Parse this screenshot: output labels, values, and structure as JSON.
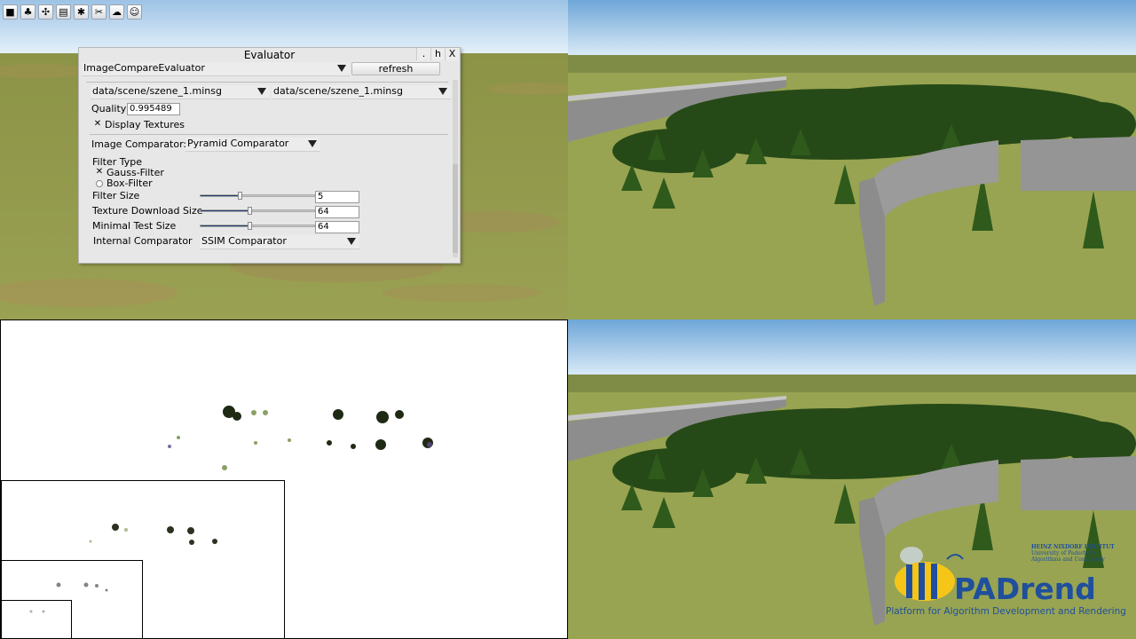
{
  "toolbar": {
    "icons": [
      "folder-icon",
      "tree-icon",
      "puzzle-icon",
      "notepad-icon",
      "gear-icon",
      "tools-icon",
      "weather-icon",
      "smiley-icon"
    ],
    "glyphs": [
      "■",
      "♣",
      "✣",
      "▤",
      "✱",
      "✂",
      "☁",
      "☺"
    ]
  },
  "evaluator": {
    "title": "Evaluator",
    "window_buttons": [
      ".",
      "h",
      "X"
    ],
    "evaluator_select": "ImageCompareEvaluator",
    "refresh_label": "refresh",
    "scene_left": "data/scene/szene_1.minsg",
    "scene_right": "data/scene/szene_1.minsg",
    "quality_label": "Quality",
    "quality_value": "0.995489",
    "display_textures_label": "Display Textures",
    "image_comparator_label": "Image Comparator:",
    "image_comparator_value": "Pyramid Comparator",
    "filter_type_label": "Filter Type",
    "gauss_filter_label": "Gauss-Filter",
    "box_filter_label": "Box-Filter",
    "selected_filter": "Gauss-Filter",
    "filter_size_label": "Filter Size",
    "filter_size_value": "5",
    "filter_size_level": 0.34,
    "texture_download_label": "Texture Download Size",
    "texture_download_value": "64",
    "texture_download_level": 0.43,
    "minimal_test_label": "Minimal Test Size",
    "minimal_test_value": "64",
    "minimal_test_level": 0.43,
    "internal_comparator_label": "Internal Comparator",
    "internal_comparator_value": "SSIM Comparator"
  },
  "logo": {
    "name": "PADrend",
    "subtitle": "Platform for Algorithm Development and Rendering",
    "institute": "HEINZ NIXDORF INSTITUT",
    "university_line1": "University of Paderborn",
    "university_line2": "Algorithms and Complexity"
  },
  "colors": {
    "sky_top": "#8fb8dd",
    "sky_bottom": "#dcecf7",
    "ground": "#8f9a4a",
    "brand_blue": "#1f4f9d",
    "brand_yellow": "#f5c518"
  }
}
